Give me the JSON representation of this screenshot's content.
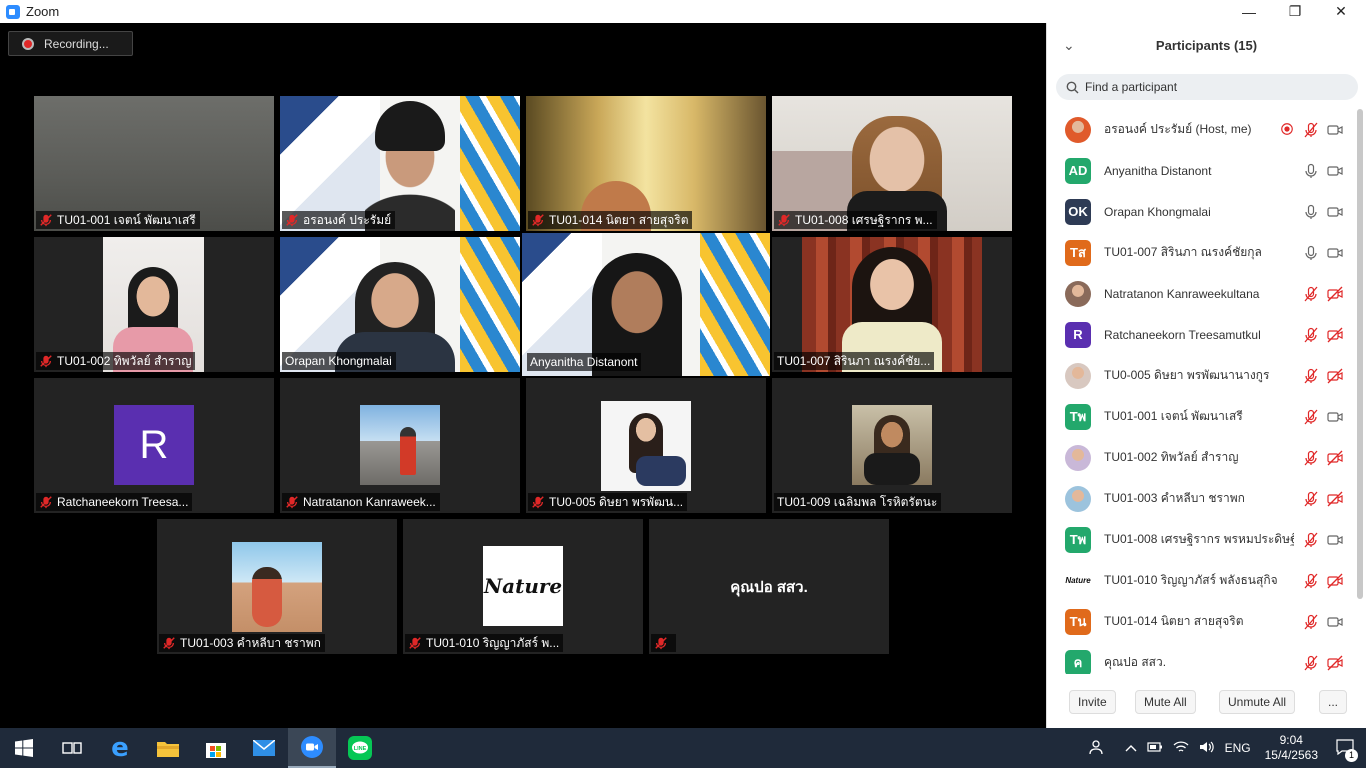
{
  "window": {
    "title": "Zoom",
    "minimize": "—",
    "maximize": "❐",
    "close": "✕"
  },
  "recording": {
    "label": "Recording..."
  },
  "tiles": [
    {
      "name": "TU01-001 เจตน์ พัฒนาเสรี",
      "muted": true
    },
    {
      "name": "อรอนงค์ ประรัมย์",
      "muted": true
    },
    {
      "name": "TU01-014 นิตยา สายสุจริต",
      "muted": true
    },
    {
      "name": "TU01-008 เศรษฐิรากร พ...",
      "muted": true
    },
    {
      "name": "TU01-002 ทิพวัลย์ สำราญ",
      "muted": true
    },
    {
      "name": "Orapan Khongmalai",
      "muted": false
    },
    {
      "name": "Anyanitha Distanont",
      "muted": false
    },
    {
      "name": "TU01-007 สิรินภา  ณรงค์ชัย...",
      "muted": false
    },
    {
      "name": "Ratchaneekorn Treesa...",
      "muted": true,
      "avatar_letter": "R"
    },
    {
      "name": "Natratanon Kanraweek...",
      "muted": true
    },
    {
      "name": "TU0-005 ดิษยา พรพัฒน...",
      "muted": true
    },
    {
      "name": "TU01-009 เฉลิมพล โรหิตรัตนะ",
      "muted": false
    },
    {
      "name": "TU01-003 คำหลีบา ชราพก",
      "muted": true
    },
    {
      "name": "TU01-010 ริญญาภัสร์ พ...",
      "muted": true,
      "logo_text": "Nature"
    },
    {
      "name": "",
      "muted": true,
      "center_text": "คุณปอ สสว."
    }
  ],
  "panel": {
    "title": "Participants (15)",
    "search_placeholder": "Find a participant",
    "participants": [
      {
        "name": "อรอนงค์ ประรัมย์ (Host, me)",
        "avatar": "photo",
        "color": "#e05a2b",
        "mic": "muted",
        "video": "on",
        "recording": true
      },
      {
        "name": "Anyanitha Distanont",
        "avatar": "AD",
        "color": "#23a86c",
        "mic": "on",
        "video": "on"
      },
      {
        "name": "Orapan Khongmalai",
        "avatar": "OK",
        "color": "#2e3b55",
        "mic": "on",
        "video": "on"
      },
      {
        "name": "TU01-007 สิรินภา  ณรงค์ชัยกุล",
        "avatar": "Tส",
        "color": "#e06a1b",
        "mic": "on",
        "video": "on"
      },
      {
        "name": "Natratanon Kanraweekultana",
        "avatar": "photo",
        "color": "#8a6a5a",
        "mic": "muted",
        "video": "off"
      },
      {
        "name": "Ratchaneekorn Treesamutkul",
        "avatar": "R",
        "color": "#5a2fb0",
        "mic": "muted",
        "video": "off"
      },
      {
        "name": "TU0-005 ดิษยา พรพัฒนานางกูร",
        "avatar": "photo",
        "color": "#d8c8c0",
        "mic": "muted",
        "video": "off"
      },
      {
        "name": "TU01-001 เจตน์ พัฒนาเสรี",
        "avatar": "Tพ",
        "color": "#23a86c",
        "mic": "muted",
        "video": "on"
      },
      {
        "name": "TU01-002 ทิพวัลย์ สำราญ",
        "avatar": "photo",
        "color": "#c9b8d8",
        "mic": "muted",
        "video": "off"
      },
      {
        "name": "TU01-003 คำหลีบา ชราพก",
        "avatar": "photo",
        "color": "#9cc3dd",
        "mic": "muted",
        "video": "off"
      },
      {
        "name": "TU01-008 เศรษฐิรากร พรหมประดิษฐ์",
        "avatar": "Tพ",
        "color": "#23a86c",
        "mic": "muted",
        "video": "on"
      },
      {
        "name": "TU01-010 ริญญาภัสร์ พลังธนสุกิจ",
        "avatar": "logo",
        "color": "#ffffff",
        "mic": "muted",
        "video": "off"
      },
      {
        "name": "TU01-014 นิตยา สายสุจริต",
        "avatar": "Tน",
        "color": "#e06a1b",
        "mic": "muted",
        "video": "on"
      },
      {
        "name": "คุณปอ สสว.",
        "avatar": "ค",
        "color": "#23a86c",
        "mic": "muted",
        "video": "off"
      }
    ],
    "buttons": {
      "invite": "Invite",
      "mute_all": "Mute All",
      "unmute_all": "Unmute All",
      "more": "..."
    }
  },
  "taskbar": {
    "clock_time": "9:04",
    "clock_date": "15/4/2563",
    "language": "ENG",
    "notifications": "1",
    "apps": [
      "start-icon",
      "task-view-icon",
      "edge-icon",
      "file-explorer-icon",
      "store-icon",
      "mail-icon",
      "zoom-icon",
      "line-icon"
    ]
  }
}
